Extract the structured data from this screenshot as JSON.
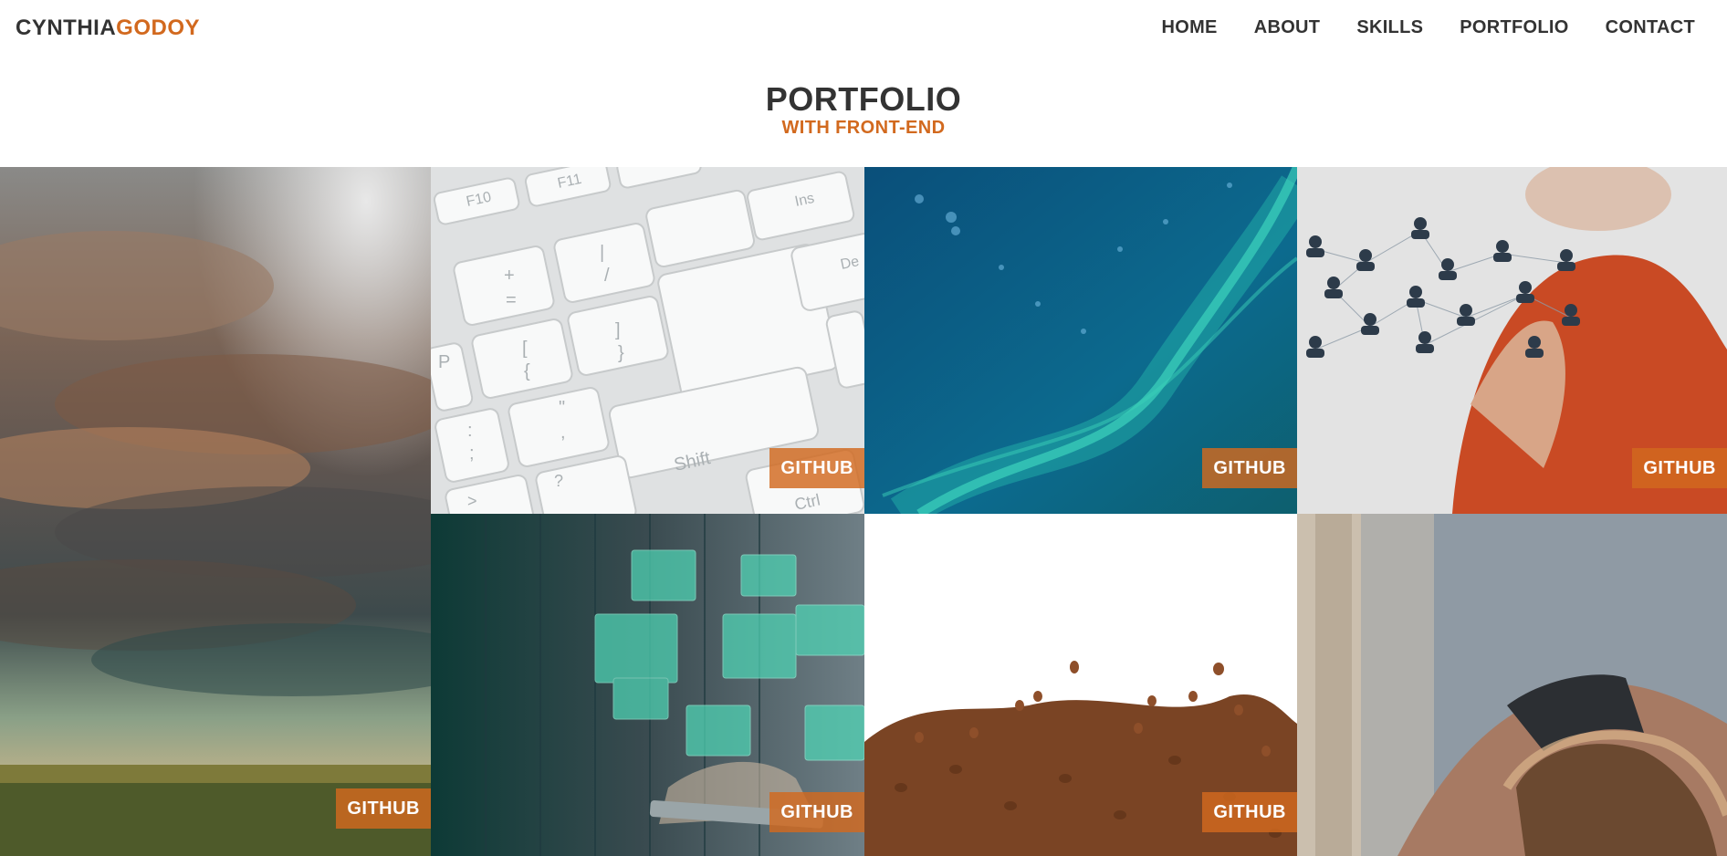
{
  "brand": {
    "first": "CYNTHIA",
    "last": "GODOY",
    "accent": "#d2691e"
  },
  "nav": {
    "home": "HOME",
    "about": "ABOUT",
    "skills": "SKILLS",
    "portfolio": "PORTFOLIO",
    "contact": "CONTACT"
  },
  "section": {
    "title": "PORTFOLIO",
    "subtitle": "WITH FRONT-END"
  },
  "projects": [
    {
      "image": "storm-clouds-over-field",
      "link_label": "GITHUB"
    },
    {
      "image": "white-keyboard-closeup",
      "link_label": "GITHUB"
    },
    {
      "image": "blue-digital-network-waves",
      "link_label": "GITHUB"
    },
    {
      "image": "hand-touching-people-network",
      "link_label": "GITHUB"
    },
    {
      "image": "server-room-hologram-folders",
      "link_label": "GITHUB"
    },
    {
      "image": "coffee-beans",
      "link_label": "GITHUB"
    },
    {
      "image": "woman-stretching-yoga",
      "link_label": ""
    }
  ],
  "keyboard": {
    "f10": "F10",
    "f11": "F11",
    "ins": "Ins",
    "del": "De",
    "shift": "Shift",
    "plus": "+",
    "eq": "=",
    "slash": "/",
    "bar": "|",
    "lbr": "[",
    "lcb": "{",
    "rbr": "]",
    "rcb": "}",
    "p": "P",
    "colon": ":",
    "semi": ";",
    "quote": "\"",
    "comma": ",",
    "q": "?",
    "gt": ">",
    "ctrl": "Ctrl"
  }
}
